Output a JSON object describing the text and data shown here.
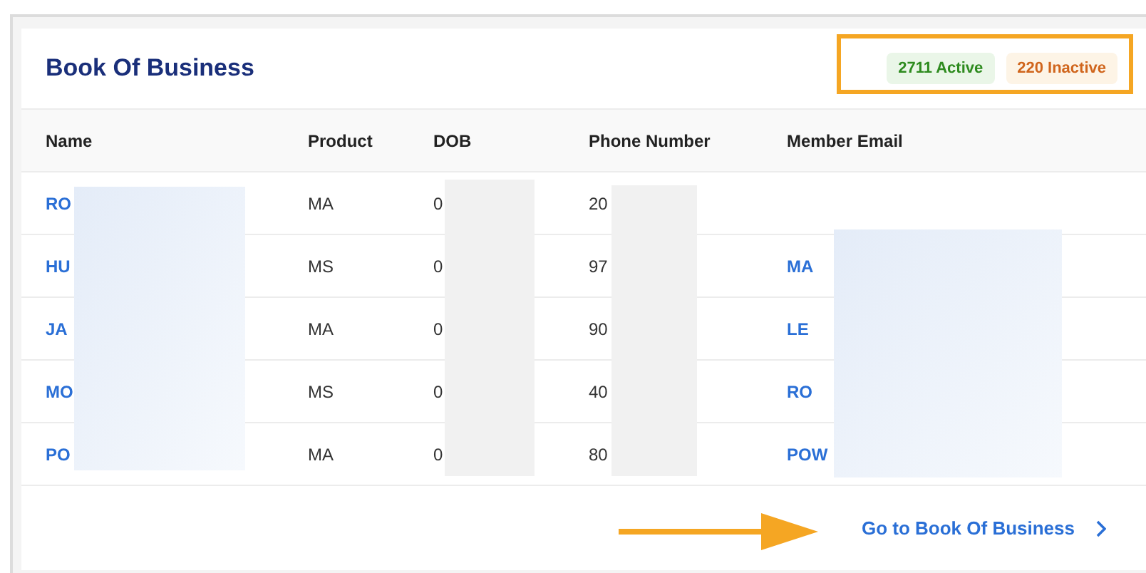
{
  "card": {
    "title": "Book Of Business",
    "badges": [
      {
        "label": "2711 Active",
        "kind": "active"
      },
      {
        "label": "220 Inactive",
        "kind": "inactive"
      }
    ]
  },
  "table": {
    "columns": [
      "Name",
      "Product",
      "DOB",
      "Phone Number",
      "Member Email"
    ],
    "rows": [
      {
        "name": "RO",
        "product": "MA",
        "dob": "0",
        "phone": "20",
        "email": ""
      },
      {
        "name": "HU",
        "product": "MS",
        "dob": "0",
        "phone": "97",
        "email": "MA"
      },
      {
        "name": "JA",
        "product": "MA",
        "dob": "0",
        "phone": "90",
        "email": "LE"
      },
      {
        "name": "MO",
        "product": "MS",
        "dob": "0",
        "phone": "40",
        "email": "RO"
      },
      {
        "name": "PO",
        "product": "MA",
        "dob": "0",
        "phone": "80",
        "email": "POW"
      }
    ]
  },
  "footer": {
    "link": "Go to Book Of Business"
  }
}
